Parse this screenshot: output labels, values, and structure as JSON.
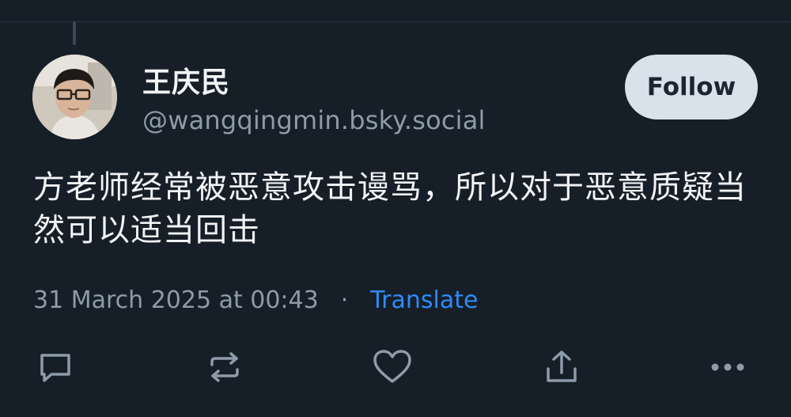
{
  "post": {
    "author": {
      "display_name": "王庆民",
      "handle": "@wangqingmin.bsky.social"
    },
    "follow_label": "Follow",
    "text": "方老师经常被恶意攻击谩骂，所以对于恶意质疑当然可以适当回击",
    "timestamp": "31 March 2025 at 00:43",
    "separator": "·",
    "translate_label": "Translate"
  },
  "actions": [
    {
      "icon": "reply-icon"
    },
    {
      "icon": "repost-icon"
    },
    {
      "icon": "like-icon"
    },
    {
      "icon": "share-icon"
    },
    {
      "icon": "more-options-icon"
    }
  ],
  "colors": {
    "background": "#161e27",
    "accent_link": "#2f8af5",
    "muted_text": "#8d9baa",
    "button_bg": "#d9e1ea"
  }
}
